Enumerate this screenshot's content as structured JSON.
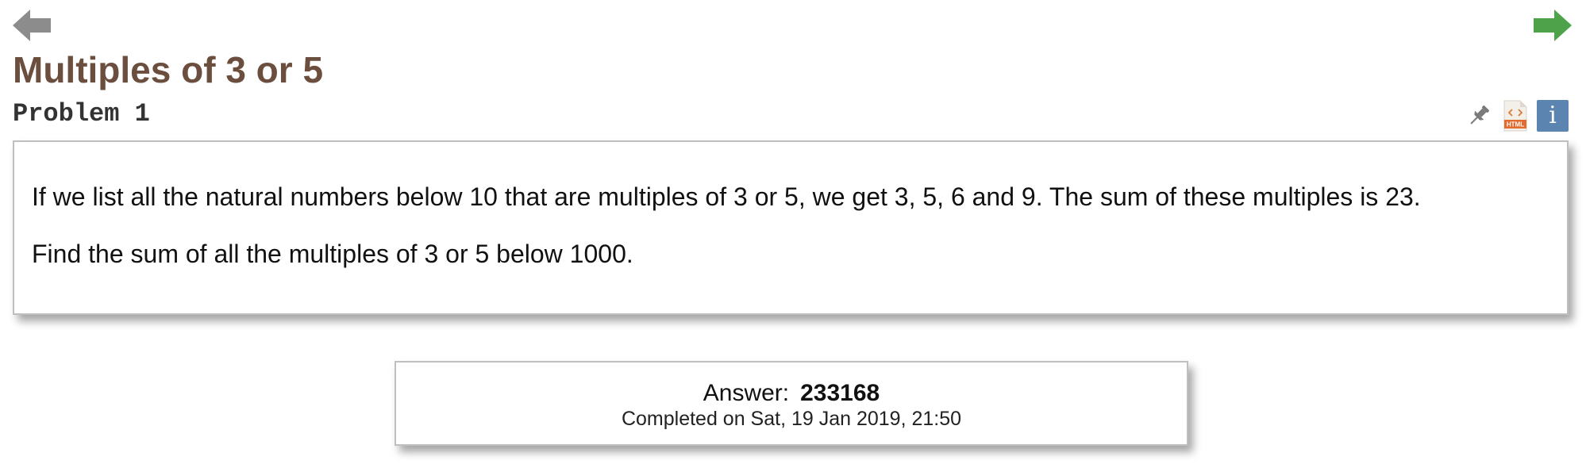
{
  "navigation": {
    "previous_icon": "arrow-left-icon",
    "previous_color": "#8c8c8c",
    "next_icon": "arrow-right-icon",
    "next_color": "#4ea34a"
  },
  "problem": {
    "title": "Multiples of 3 or 5",
    "number_label": "Problem 1",
    "paragraphs": [
      "If we list all the natural numbers below 10 that are multiples of 3 or 5, we get 3, 5, 6 and 9. The sum of these multiples is 23.",
      "Find the sum of all the multiples of 3 or 5 below 1000."
    ]
  },
  "tools": {
    "pin_icon": "pin-icon",
    "html_icon": "html-file-icon",
    "html_icon_label": "HTML",
    "info_icon": "info-icon",
    "info_label": "i",
    "info_color": "#5b84b1"
  },
  "answer": {
    "label": "Answer:",
    "value": "233168",
    "completed_text": "Completed on Sat, 19 Jan 2019, 21:50"
  },
  "colors": {
    "title": "#6b4e3d",
    "box_border": "#bfbfbf"
  }
}
